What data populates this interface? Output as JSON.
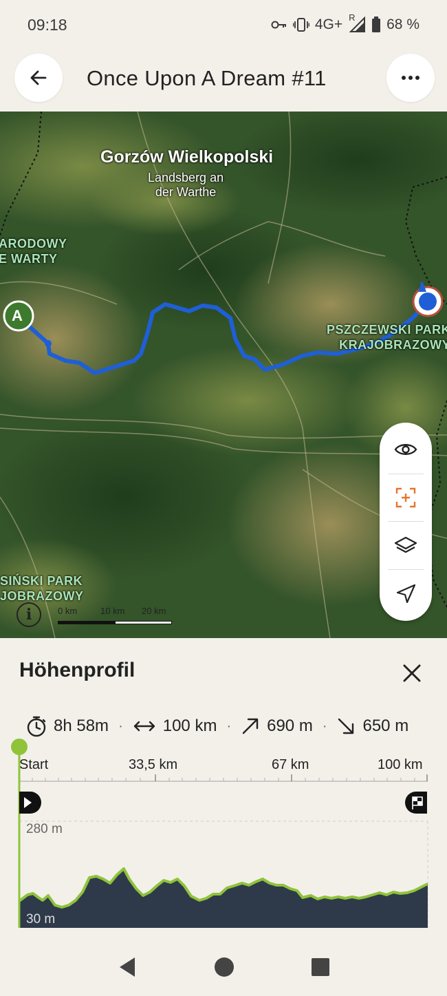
{
  "status": {
    "time": "09:18",
    "network": "4G+",
    "roaming": "R",
    "battery": "68 %"
  },
  "header": {
    "title": "Once Upon A Dream #11"
  },
  "map": {
    "city": "Gorzów Wielkopolski",
    "city_alt_line1": "Landsberg an",
    "city_alt_line2": "der Warthe",
    "park_left_top_line1": "ARODOWY",
    "park_left_top_line2": "E WARTY",
    "park_right_line1": "PSZCZEWSKI PARK",
    "park_right_line2": "KRAJOBRAZOWY",
    "park_left_bottom_line1": "SIŃSKI PARK",
    "park_left_bottom_line2": "JOBRAZOWY",
    "start_marker": "A",
    "info_label": "i",
    "scale_labels": [
      "0 km",
      "10 km",
      "20 km"
    ]
  },
  "sheet": {
    "title": "Höhenprofil",
    "stats": {
      "duration": "8h 58m",
      "distance": "100 km",
      "ascent": "690 m",
      "descent": "650 m"
    },
    "separator": "·",
    "axis_labels": [
      "Start",
      "33,5 km",
      "67 km",
      "100 km"
    ],
    "elevation_max": "280 m",
    "elevation_min": "30 m"
  },
  "colors": {
    "route": "#1f5fd6",
    "elevation_line": "#8fc33a",
    "elevation_fill": "#2e3a4a",
    "accent_orange": "#e8742a"
  }
}
